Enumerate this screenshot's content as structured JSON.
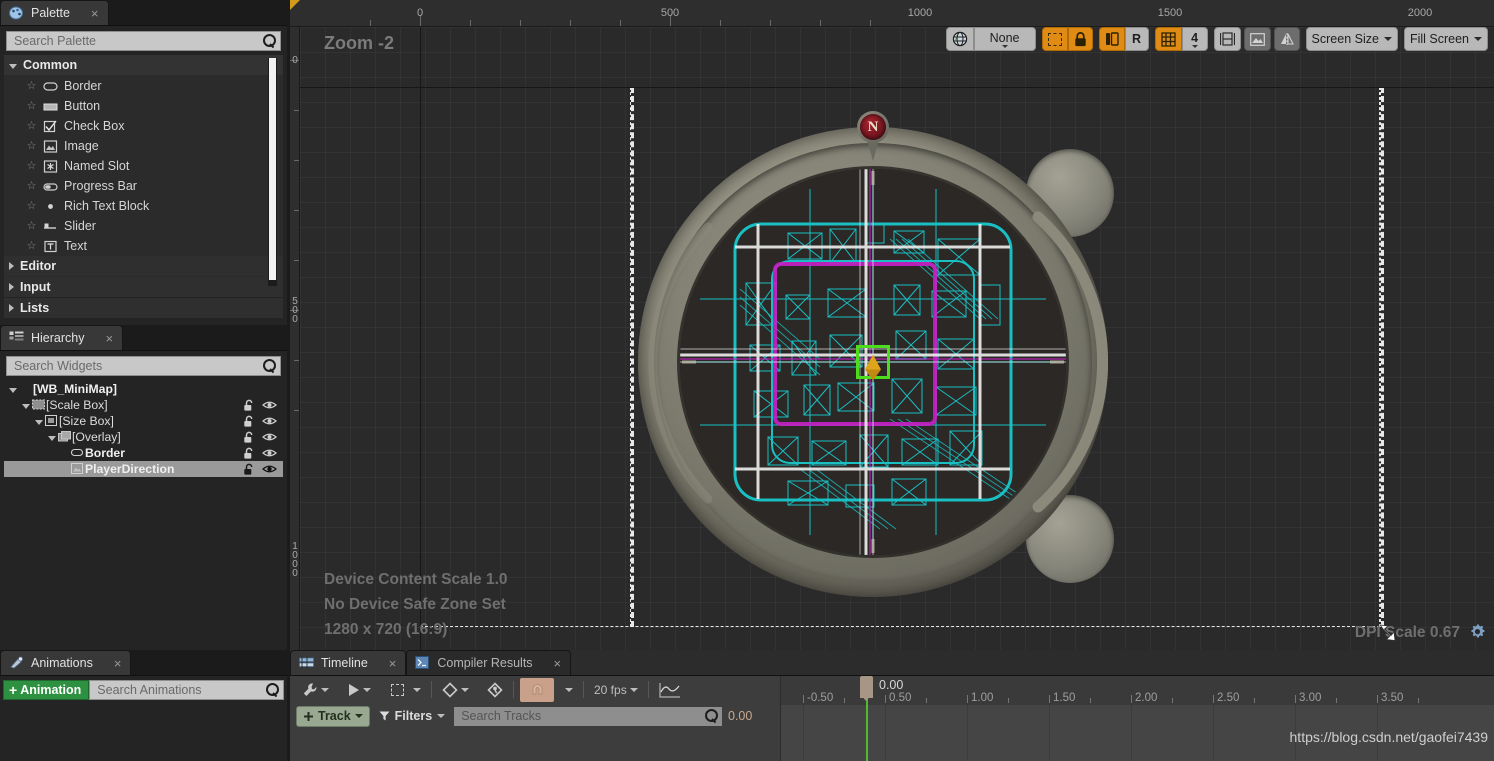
{
  "palette": {
    "tab_label": "Palette",
    "tab_icon": "palette-icon",
    "close_label": "×",
    "search_placeholder": "Search Palette",
    "categories": [
      {
        "label": "Common",
        "expanded": true,
        "items": [
          {
            "label": "Border",
            "icon": "border-widget-icon"
          },
          {
            "label": "Button",
            "icon": "button-widget-icon"
          },
          {
            "label": "Check Box",
            "icon": "checkbox-widget-icon"
          },
          {
            "label": "Image",
            "icon": "image-widget-icon"
          },
          {
            "label": "Named Slot",
            "icon": "named-slot-widget-icon"
          },
          {
            "label": "Progress Bar",
            "icon": "progress-bar-widget-icon"
          },
          {
            "label": "Rich Text Block",
            "icon": "rich-text-block-widget-icon"
          },
          {
            "label": "Slider",
            "icon": "slider-widget-icon"
          },
          {
            "label": "Text",
            "icon": "text-widget-icon"
          }
        ]
      },
      {
        "label": "Editor",
        "expanded": false,
        "items": []
      },
      {
        "label": "Input",
        "expanded": false,
        "items": []
      },
      {
        "label": "Lists",
        "expanded": false,
        "items": []
      }
    ]
  },
  "hierarchy": {
    "tab_label": "Hierarchy",
    "tab_icon": "hierarchy-icon",
    "close_label": "×",
    "search_placeholder": "Search Widgets",
    "rows": [
      {
        "label": "[WB_MiniMap]",
        "depth": 0,
        "icon": "none",
        "selected": false,
        "has_toggles": false,
        "bold": true
      },
      {
        "label": "[Scale Box]",
        "depth": 1,
        "icon": "scale-box-icon",
        "selected": false,
        "has_toggles": true,
        "bold": false
      },
      {
        "label": "[Size Box]",
        "depth": 2,
        "icon": "size-box-icon",
        "selected": false,
        "has_toggles": true,
        "bold": false
      },
      {
        "label": "[Overlay]",
        "depth": 3,
        "icon": "overlay-icon",
        "selected": false,
        "has_toggles": true,
        "bold": false
      },
      {
        "label": "Border",
        "depth": 4,
        "icon": "border-widget-icon",
        "selected": false,
        "has_toggles": true,
        "bold": true
      },
      {
        "label": "PlayerDirection",
        "depth": 4,
        "icon": "image-widget-icon",
        "selected": true,
        "has_toggles": true,
        "bold": true
      }
    ]
  },
  "animations": {
    "tab_label": "Animations",
    "tab_icon": "animation-icon",
    "close_label": "×",
    "add_button_label": "Animation",
    "add_button_plus": "+",
    "search_placeholder": "Search Animations"
  },
  "viewport": {
    "zoom_label": "Zoom -2",
    "device_content_scale": "Device Content Scale 1.0",
    "safe_zone": "No Device Safe Zone Set",
    "resolution": "1280 x 720 (16:9)",
    "dpi_scale": "DPI Scale 0.67",
    "settings_icon": "gear-icon",
    "ruler_h_labels": [
      "0",
      "500",
      "1000",
      "1500",
      "2000"
    ],
    "ruler_v_labels": [
      "0",
      "500",
      "1000"
    ],
    "toolbar": {
      "globe_icon": "globe-icon",
      "zoom_mode_label": "None",
      "dashed_box_icon": "selection-outline-icon",
      "lock_icon": "lock-icon",
      "localization_icon": "localization-preview-icon",
      "rtl_label": "R",
      "grid_icon": "grid-snap-icon",
      "grid_size_label": "4",
      "layout_icon": "layout-guides-icon",
      "image_icon": "preview-image-icon",
      "mirror_icon": "mirror-icon",
      "screen_size_label": "Screen Size",
      "fill_screen_label": "Fill Screen"
    },
    "minimap": {
      "compass_label": "N",
      "selection_name": "PlayerDirection"
    }
  },
  "timeline": {
    "tabs": [
      {
        "label": "Timeline",
        "icon": "timeline-icon",
        "active": true,
        "close_label": "×"
      },
      {
        "label": "Compiler Results",
        "icon": "compiler-results-icon",
        "active": false,
        "close_label": "×"
      }
    ],
    "toolbar": {
      "wrench_icon": "wrench-icon",
      "play_icon": "play-icon",
      "selection_icon": "selection-range-icon",
      "key_icon": "keyframe-icon",
      "key_interp_icon": "keyframe-interp-icon",
      "snap_icon": "magnet-snap-icon",
      "fps_label": "20 fps",
      "curve_icon": "curve-editor-icon"
    },
    "track_button_label": "Track",
    "track_button_icon": "add-track-icon",
    "filters_label": "Filters",
    "filters_icon": "filter-icon",
    "search_placeholder": "Search Tracks",
    "current_time": "0.00",
    "playhead_label": "0.00",
    "ruler_labels": [
      "-0.50",
      "0.50",
      "1.00",
      "1.50",
      "2.00",
      "2.50",
      "3.00",
      "3.50"
    ],
    "watermark": "https://blog.csdn.net/gaofei7439"
  },
  "colors": {
    "accent_orange": "#e08c14",
    "selection_green": "#4cdd1e",
    "add_green": "#2e9141",
    "playhead_green": "#4fbc2f",
    "compass_red": "#7d1822",
    "player_gold": "#e0a41b",
    "map_cyan": "#19c8cc",
    "map_magenta": "#c81fc8"
  }
}
